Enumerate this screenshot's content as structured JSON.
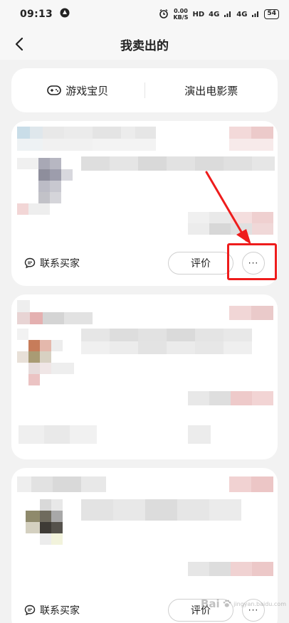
{
  "status_bar": {
    "time": "09:13",
    "net_speed_value": "0.00",
    "net_speed_unit": "KB/S",
    "hd_label": "HD",
    "signal_1": "4G",
    "signal_2": "4G",
    "battery": "54"
  },
  "nav": {
    "title": "我卖出的"
  },
  "tabs": [
    {
      "label": "游戏宝贝"
    },
    {
      "label": "演出电影票"
    }
  ],
  "orders": [
    {
      "contact_label": "联系买家",
      "rate_label": "评价",
      "more_label": "···"
    },
    {
      "contact_label": "",
      "rate_label": "",
      "more_label": ""
    },
    {
      "contact_label": "联系买家",
      "rate_label": "评价",
      "more_label": "···"
    }
  ],
  "watermark": {
    "text": "Bai",
    "sub": "jingyan.baidu.com"
  },
  "colors": {
    "annotation": "#ee1c1c",
    "background": "#f2f2f2",
    "card": "#ffffff"
  }
}
